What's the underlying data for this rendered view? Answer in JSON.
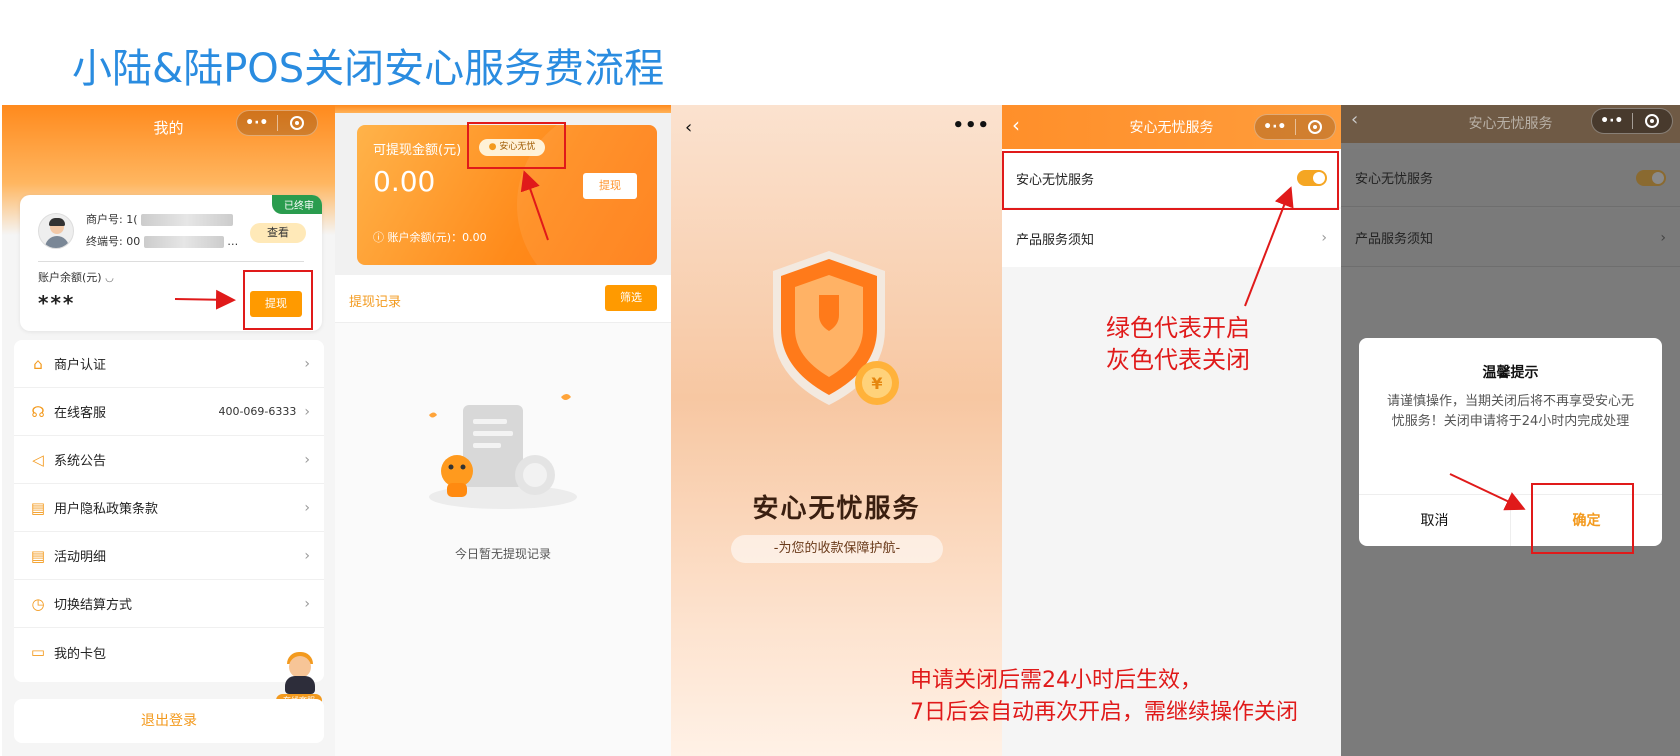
{
  "slide": {
    "title": "小陆&陆POS关闭安心服务费流程"
  },
  "colors": {
    "accent": "#ff9a00",
    "annotation": "#e01a1a",
    "title_blue": "#2a8ce0",
    "success": "#2a9c4e"
  },
  "panel1": {
    "title": "我的",
    "status": "已终审",
    "merchant_no_label": "商户号:",
    "merchant_no_value": "1(",
    "terminal_no_label": "终端号:",
    "terminal_no_value": "00",
    "terminal_no_suffix": "…",
    "view_button": "查看",
    "balance_label": "账户余额(元)",
    "balance_value": "***",
    "withdraw_button": "提现",
    "menu": [
      {
        "icon": "home-icon",
        "glyph": "⌂",
        "label": "商户认证",
        "extra": ""
      },
      {
        "icon": "headset-icon",
        "glyph": "☊",
        "label": "在线客服",
        "extra": "400-069-6333"
      },
      {
        "icon": "megaphone-icon",
        "glyph": "◁",
        "label": "系统公告",
        "extra": ""
      },
      {
        "icon": "document-icon",
        "glyph": "▤",
        "label": "用户隐私政策条款",
        "extra": ""
      },
      {
        "icon": "list-icon",
        "glyph": "▤",
        "label": "活动明细",
        "extra": ""
      },
      {
        "icon": "clock-icon",
        "glyph": "◷",
        "label": "切换结算方式",
        "extra": ""
      },
      {
        "icon": "card-icon",
        "glyph": "▭",
        "label": "我的卡包",
        "extra": ""
      }
    ],
    "online_service_badge": "在线客服",
    "logout": "退出登录"
  },
  "panel2": {
    "withdrawable_label": "可提现金额(元)",
    "badge": "安心无忧",
    "amount": "0.00",
    "withdraw_button": "提现",
    "account_balance": "账户余额(元)：0.00",
    "records_title": "提现记录",
    "filter_button": "筛选",
    "empty_text": "今日暂无提现记录"
  },
  "panel3": {
    "title": "安心无忧服务",
    "subtitle": "-为您的收款保障护航-"
  },
  "panel4": {
    "title": "安心无忧服务",
    "rows": [
      {
        "label": "安心无忧服务",
        "control": "toggle",
        "state": "on"
      },
      {
        "label": "产品服务须知",
        "control": "chevron"
      }
    ],
    "annotation_lines": [
      "绿色代表开启",
      "灰色代表关闭"
    ]
  },
  "bottom_annotation": [
    "申请关闭后需24小时后生效，",
    "7日后会自动再次开启，需继续操作关闭"
  ],
  "panel5": {
    "title": "安心无忧服务",
    "rows": [
      {
        "label": "安心无忧服务",
        "control": "toggle",
        "state": "on"
      },
      {
        "label": "产品服务须知",
        "control": "chevron"
      }
    ],
    "dialog": {
      "title": "温馨提示",
      "body": "请谨慎操作，当期关闭后将不再享受安心无忧服务！关闭申请将于24小时内完成处理",
      "cancel": "取消",
      "confirm": "确定"
    }
  }
}
